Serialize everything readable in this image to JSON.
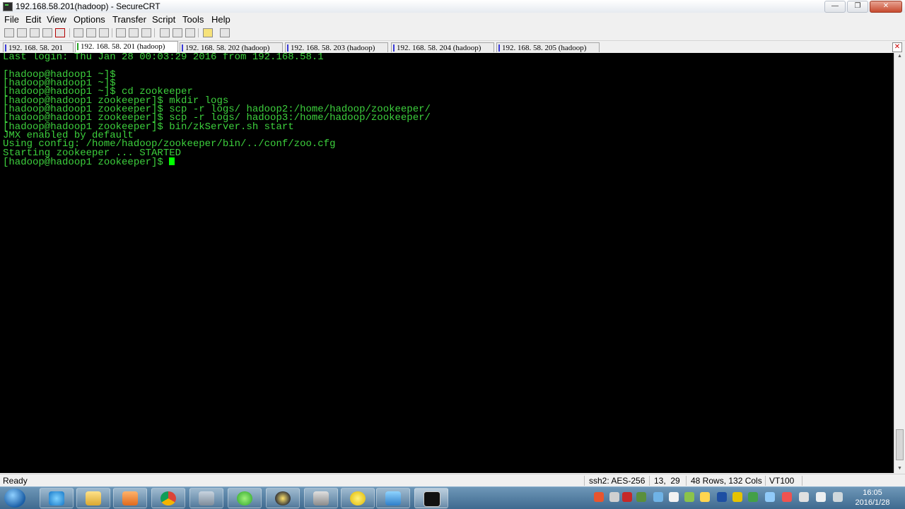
{
  "window": {
    "title": "192.168.58.201(hadoop) - SecureCRT"
  },
  "menu": [
    "File",
    "Edit",
    "View",
    "Options",
    "Transfer",
    "Script",
    "Tools",
    "Help"
  ],
  "tabs": [
    {
      "label": "192. 168. 58. 201",
      "active": false
    },
    {
      "label": "192. 168. 58. 201 (hadoop)",
      "active": true
    },
    {
      "label": "192. 168. 58. 202 (hadoop)",
      "active": false
    },
    {
      "label": "192. 168. 58. 203 (hadoop)",
      "active": false
    },
    {
      "label": "192. 168. 58. 204 (hadoop)",
      "active": false
    },
    {
      "label": "192. 168. 58. 205 (hadoop)",
      "active": false
    }
  ],
  "terminal": {
    "lines": [
      "Last login: Thu Jan 28 00:03:29 2016 from 192.168.58.1",
      "",
      "[hadoop@hadoop1 ~]$",
      "[hadoop@hadoop1 ~]$",
      "[hadoop@hadoop1 ~]$ cd zookeeper",
      "[hadoop@hadoop1 zookeeper]$ mkdir logs",
      "[hadoop@hadoop1 zookeeper]$ scp -r logs/ hadoop2:/home/hadoop/zookeeper/",
      "[hadoop@hadoop1 zookeeper]$ scp -r logs/ hadoop3:/home/hadoop/zookeeper/",
      "[hadoop@hadoop1 zookeeper]$ bin/zkServer.sh start",
      "JMX enabled by default",
      "Using config: /home/hadoop/zookeeper/bin/../conf/zoo.cfg",
      "Starting zookeeper ... STARTED",
      "[hadoop@hadoop1 zookeeper]$ "
    ]
  },
  "status": {
    "ready": "Ready",
    "cipher": "ssh2: AES-256",
    "cursor_pos": "13,  29",
    "size": "48 Rows, 132 Cols",
    "emulation": "VT100"
  },
  "clock": {
    "time": "16:05",
    "date": "2016/1/28"
  },
  "colors": {
    "terminal_bg": "#000000",
    "terminal_fg": "#3dd13d",
    "cursor": "#00ff00"
  }
}
